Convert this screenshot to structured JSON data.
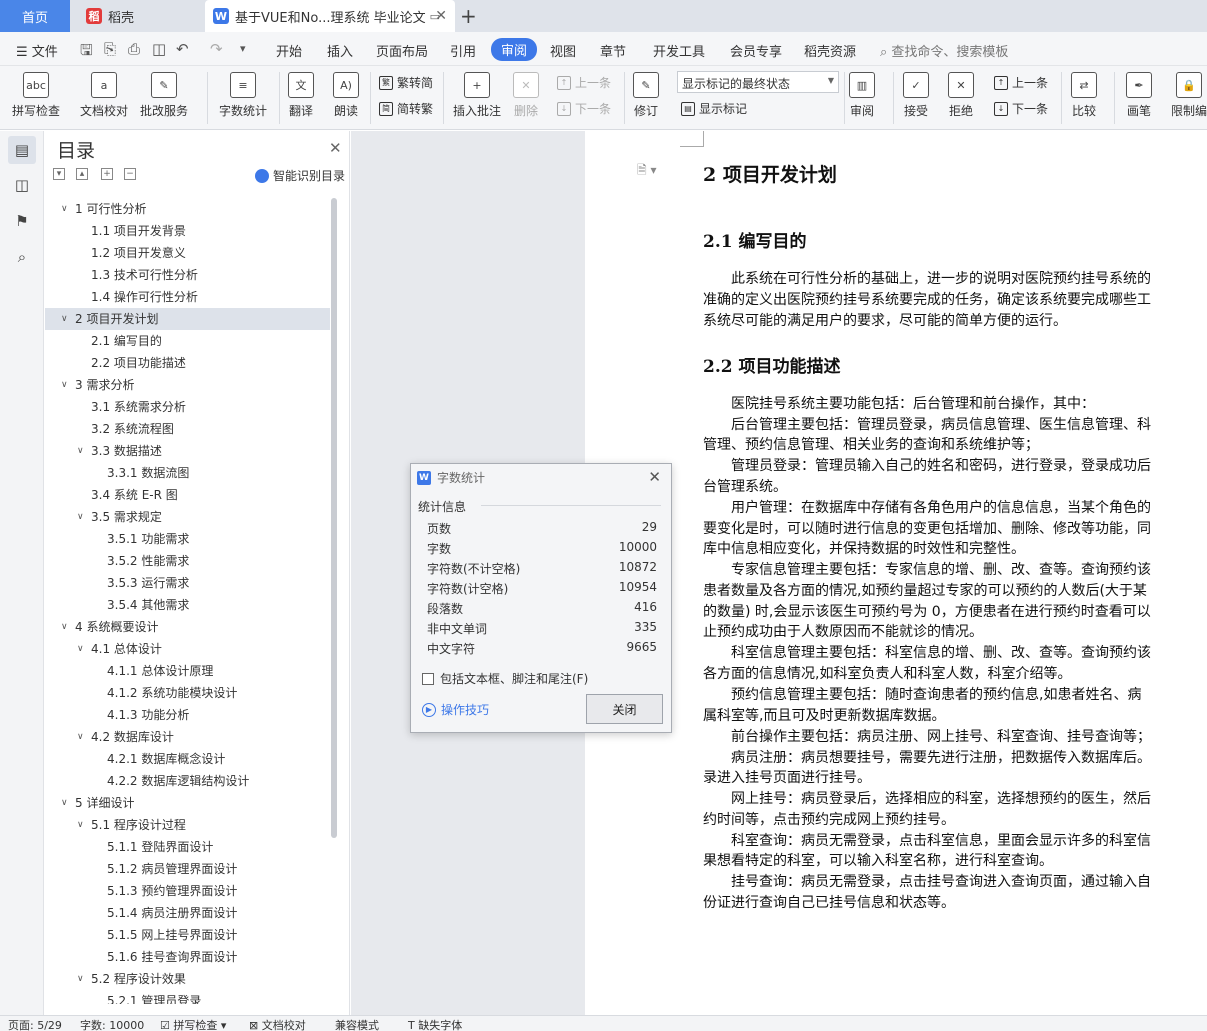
{
  "tabs": {
    "home": "首页",
    "daoke": "稻壳",
    "document": "基于VUE和No...理系统 毕业论文"
  },
  "menu": {
    "file": "文件",
    "items": [
      "开始",
      "插入",
      "页面布局",
      "引用",
      "审阅",
      "视图",
      "章节",
      "开发工具",
      "会员专享",
      "稻壳资源"
    ],
    "active": "审阅",
    "search": "查找命令、搜索模板"
  },
  "ribbon": {
    "spell_check": "拼写检查",
    "doc_proof": "文档校对",
    "batch_service": "批改服务",
    "word_count": "字数统计",
    "translate": "翻译",
    "read_aloud": "朗读",
    "trad_to_simp": "繁转简",
    "simp_to_trad": "简转繁",
    "insert_comment": "插入批注",
    "delete": "删除",
    "prev_comment": "上一条",
    "next_comment": "下一条",
    "track_changes": "修订",
    "markup_mode": "显示标记的最终状态",
    "show_markup": "显示标记",
    "review": "审阅",
    "accept": "接受",
    "reject": "拒绝",
    "prev_change": "上一条",
    "next_change": "下一条",
    "compare": "比较",
    "pen": "画笔",
    "restrict": "限制编"
  },
  "toc": {
    "title": "目录",
    "smart_toc": "智能识别目录",
    "items": [
      {
        "level": 1,
        "text": "1 可行性分析",
        "expanded": true
      },
      {
        "level": 2,
        "text": "1.1 项目开发背景"
      },
      {
        "level": 2,
        "text": "1.2 项目开发意义"
      },
      {
        "level": 2,
        "text": "1.3 技术可行性分析"
      },
      {
        "level": 2,
        "text": "1.4 操作可行性分析"
      },
      {
        "level": 1,
        "text": "2 项目开发计划",
        "expanded": true,
        "selected": true
      },
      {
        "level": 2,
        "text": "2.1 编写目的"
      },
      {
        "level": 2,
        "text": "2.2 项目功能描述"
      },
      {
        "level": 1,
        "text": "3 需求分析",
        "expanded": true
      },
      {
        "level": 2,
        "text": "3.1 系统需求分析"
      },
      {
        "level": 2,
        "text": "3.2 系统流程图"
      },
      {
        "level": 2,
        "text": "3.3 数据描述",
        "expanded": true
      },
      {
        "level": 3,
        "text": "3.3.1 数据流图"
      },
      {
        "level": 2,
        "text": "3.4 系统 E-R 图"
      },
      {
        "level": 2,
        "text": "3.5 需求规定",
        "expanded": true
      },
      {
        "level": 3,
        "text": "3.5.1 功能需求"
      },
      {
        "level": 3,
        "text": "3.5.2 性能需求"
      },
      {
        "level": 3,
        "text": "3.5.3 运行需求"
      },
      {
        "level": 3,
        "text": "3.5.4 其他需求"
      },
      {
        "level": 1,
        "text": "4 系统概要设计",
        "expanded": true
      },
      {
        "level": 2,
        "text": "4.1 总体设计",
        "expanded": true
      },
      {
        "level": 3,
        "text": "4.1.1 总体设计原理"
      },
      {
        "level": 3,
        "text": "4.1.2 系统功能模块设计"
      },
      {
        "level": 3,
        "text": "4.1.3 功能分析"
      },
      {
        "level": 2,
        "text": "4.2 数据库设计",
        "expanded": true
      },
      {
        "level": 3,
        "text": "4.2.1 数据库概念设计"
      },
      {
        "level": 3,
        "text": "4.2.2 数据库逻辑结构设计"
      },
      {
        "level": 1,
        "text": "5 详细设计",
        "expanded": true
      },
      {
        "level": 2,
        "text": "5.1 程序设计过程",
        "expanded": true
      },
      {
        "level": 3,
        "text": "5.1.1 登陆界面设计"
      },
      {
        "level": 3,
        "text": "5.1.2 病员管理界面设计"
      },
      {
        "level": 3,
        "text": "5.1.3 预约管理界面设计"
      },
      {
        "level": 3,
        "text": "5.1.4 病员注册界面设计"
      },
      {
        "level": 3,
        "text": "5.1.5 网上挂号界面设计"
      },
      {
        "level": 3,
        "text": "5.1.6 挂号查询界面设计"
      },
      {
        "level": 2,
        "text": "5.2 程序设计效果",
        "expanded": true
      },
      {
        "level": 3,
        "text": "5.2.1 管理员登录"
      }
    ]
  },
  "document": {
    "h1": "2 项目开发计划",
    "h2_1": "2.1 编写目的",
    "h2_2": "2.2 项目功能描述",
    "lines": [
      "　　此系统在可行性分析的基础上，进一步的说明对医院预约挂号系统的",
      "准确的定义出医院预约挂号系统要完成的任务，确定该系统要完成哪些工",
      "系统尽可能的满足用户的要求，尽可能的简单方便的运行。",
      "　　医院挂号系统主要功能包括：后台管理和前台操作，其中：",
      "　　后台管理主要包括：管理员登录，病员信息管理、医生信息管理、科",
      "管理、预约信息管理、相关业务的查询和系统维护等；",
      "　　管理员登录：管理员输入自己的姓名和密码，进行登录，登录成功后",
      "台管理系统。",
      "　　用户管理：在数据库中存储有各角色用户的信息信息，当某个角色的",
      "要变化是时，可以随时进行信息的变更包括增加、删除、修改等功能，同",
      "库中信息相应变化，并保持数据的时效性和完整性。",
      "　　专家信息管理主要包括：专家信息的增、删、改、查等。查询预约该",
      "患者数量及各方面的情况,如预约量超过专家的可以预约的人数后(大于某",
      "的数量) 时,会显示该医生可预约号为 0，方便患者在进行预约时查看可以",
      "止预约成功由于人数原因而不能就诊的情况。",
      "　　科室信息管理主要包括：科室信息的增、删、改、查等。查询预约该",
      "各方面的信息情况,如科室负责人和科室人数，科室介绍等。",
      "　　预约信息管理主要包括：随时查询患者的预约信息,如患者姓名、病",
      "属科室等,而且可及时更新数据库数据。",
      "　　前台操作主要包括：病员注册、网上挂号、科室查询、挂号查询等；",
      "　　病员注册：病员想要挂号，需要先进行注册，把数据传入数据库后。",
      "录进入挂号页面进行挂号。",
      "　　网上挂号：病员登录后，选择相应的科室，选择想预约的医生，然后",
      "约时间等，点击预约完成网上预约挂号。",
      "　　科室查询：病员无需登录，点击科室信息，里面会显示许多的科室信",
      "果想看特定的科室，可以输入科室名称，进行科室查询。",
      "　　挂号查询：病员无需登录，点击挂号查询进入查询页面，通过输入自",
      "份证进行查询自己已挂号信息和状态等。"
    ]
  },
  "dialog": {
    "title": "字数统计",
    "section": "统计信息",
    "stats": [
      {
        "label": "页数",
        "value": "29"
      },
      {
        "label": "字数",
        "value": "10000"
      },
      {
        "label": "字符数(不计空格)",
        "value": "10872"
      },
      {
        "label": "字符数(计空格)",
        "value": "10954"
      },
      {
        "label": "段落数",
        "value": "416"
      },
      {
        "label": "非中文单词",
        "value": "335"
      },
      {
        "label": "中文字符",
        "value": "9665"
      }
    ],
    "include_label": "包括文本框、脚注和尾注(F)",
    "include_checked": false,
    "tips": "操作技巧",
    "close_button": "关闭"
  },
  "status": {
    "page": "页面: 5/29",
    "words": "字数: 10000",
    "spell": "拼写检查",
    "proof": "文档校对",
    "compat": "兼容模式",
    "missing_font": "缺失字体"
  },
  "colors": {
    "accent": "#3d78e8",
    "tab_home": "#4a86e8",
    "daoke_logo": "#e23b3b"
  }
}
